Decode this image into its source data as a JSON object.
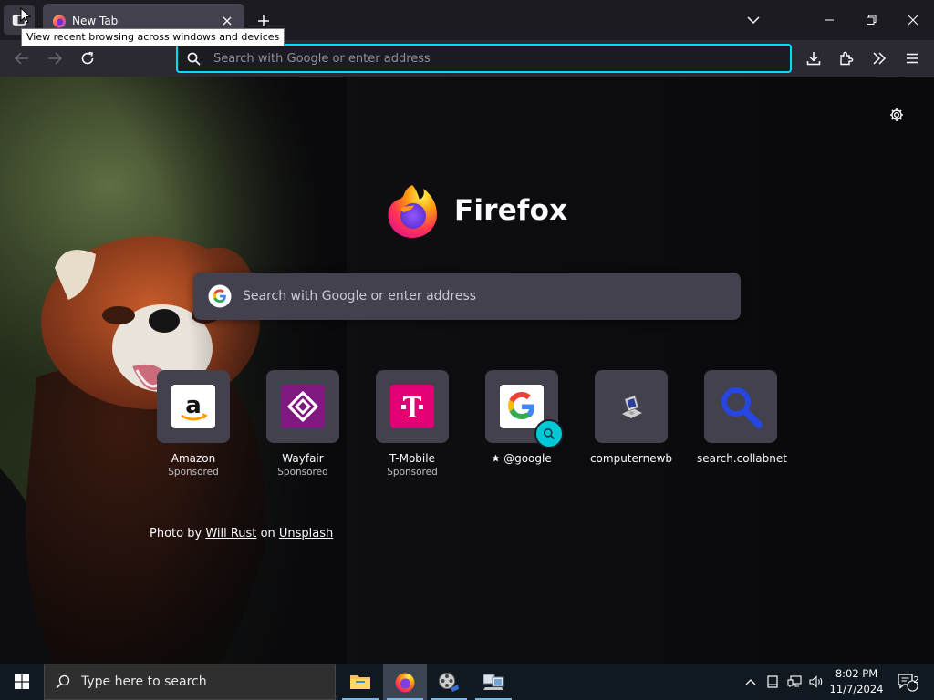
{
  "window": {
    "tab_title": "New Tab",
    "tooltip": "View recent browsing across windows and devices"
  },
  "toolbar": {
    "address_placeholder": "Search with Google or enter address"
  },
  "newtab": {
    "brand_name": "Firefox",
    "search_placeholder": "Search with Google or enter address",
    "top_sites": [
      {
        "label": "Amazon",
        "sub": "Sponsored",
        "icon": "amazon-logo"
      },
      {
        "label": "Wayfair",
        "sub": "Sponsored",
        "icon": "wayfair-logo"
      },
      {
        "label": "T-Mobile",
        "sub": "Sponsored",
        "icon": "tmobile-logo"
      },
      {
        "label": "@google",
        "sub": "",
        "icon": "google-logo"
      },
      {
        "label": "computernewb",
        "sub": "",
        "icon": "computer-icon"
      },
      {
        "label": "search.collabnet",
        "sub": "",
        "icon": "magnifier-icon"
      }
    ],
    "attribution": {
      "prefix": "Photo by",
      "author": "Will Rust",
      "middle": "on",
      "site": "Unsplash"
    }
  },
  "taskbar": {
    "search_placeholder": "Type here to search",
    "time": "8:02 PM",
    "date": "11/7/2024",
    "notification_count": "2"
  },
  "colors": {
    "accent": "#00ddff",
    "tab_bg": "#42414d",
    "nav_bg": "#2b2a33",
    "frame_bg": "#1c1b22",
    "taskbar_bg": "#101820"
  }
}
